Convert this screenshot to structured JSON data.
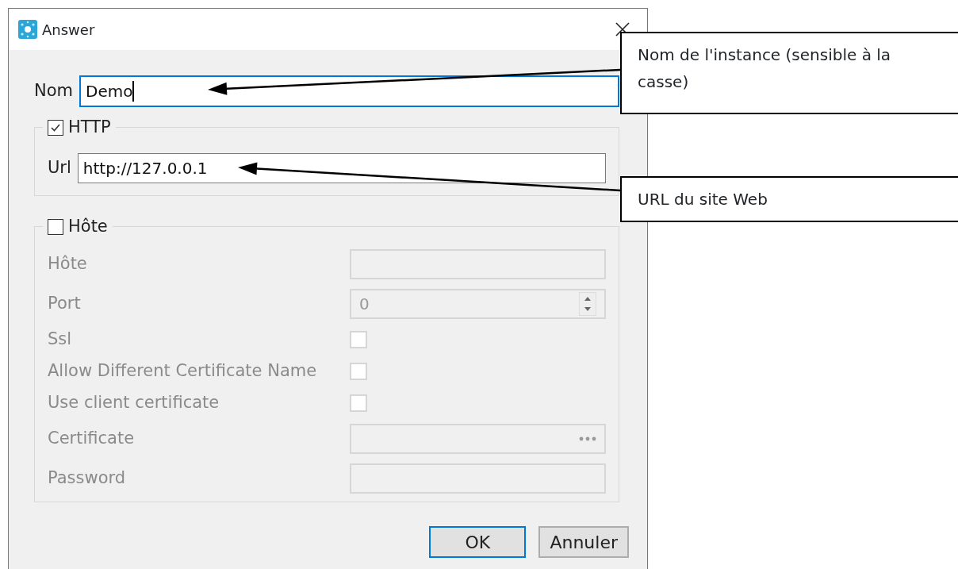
{
  "window": {
    "title": "Answer"
  },
  "name_field": {
    "label": "Nom",
    "value": "Demo",
    "focused": true
  },
  "http_group": {
    "label": "HTTP",
    "checked": true,
    "url": {
      "label": "Url",
      "value": "http://127.0.0.1"
    }
  },
  "host_group": {
    "label": "Hôte",
    "checked": false,
    "rows": [
      {
        "kind": "text",
        "label": "Hôte"
      },
      {
        "kind": "spin",
        "label": "Port",
        "value": "0"
      },
      {
        "kind": "check",
        "label": "Ssl",
        "checked": false
      },
      {
        "kind": "check",
        "label": "Allow Different Certificate Name",
        "checked": false
      },
      {
        "kind": "check",
        "label": "Use client certificate",
        "checked": false
      },
      {
        "kind": "browse",
        "label": "Certificate"
      },
      {
        "kind": "text",
        "label": "Password"
      }
    ]
  },
  "buttons": [
    {
      "label": "OK",
      "default": true
    },
    {
      "label": "Annuler",
      "default": false
    }
  ],
  "callouts": [
    {
      "text": "Nom de l'instance (sensible à la casse)"
    },
    {
      "text": "URL du site Web"
    }
  ]
}
